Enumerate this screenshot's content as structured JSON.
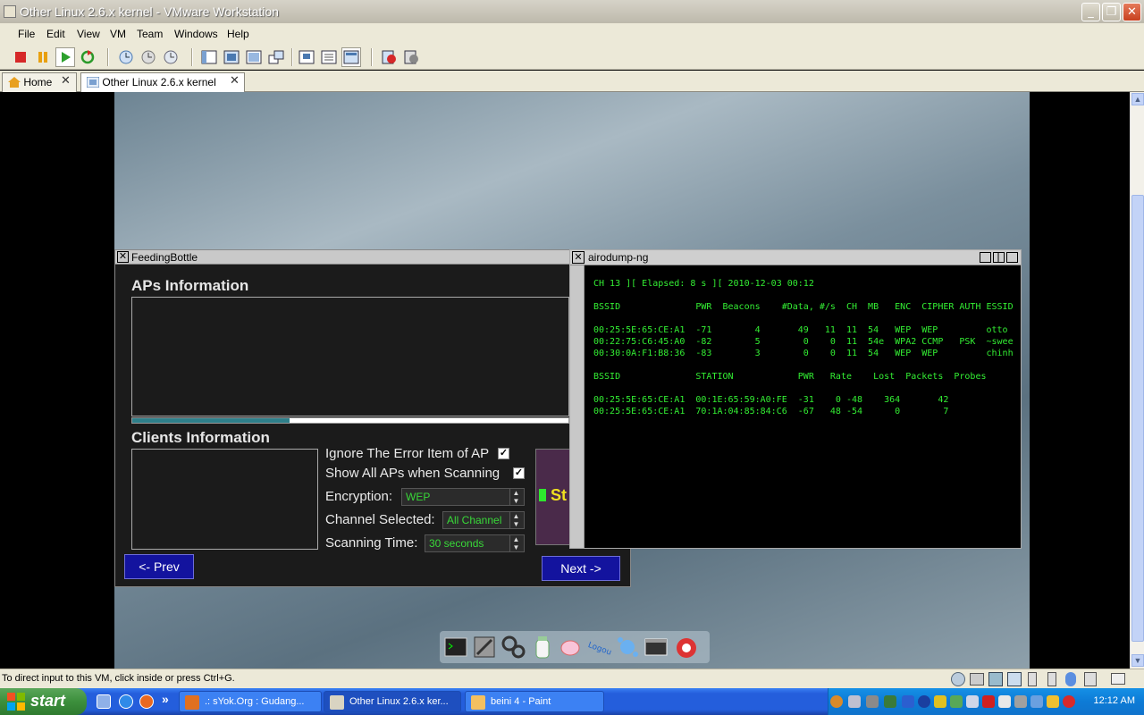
{
  "window": {
    "title": "Other Linux 2.6.x kernel - VMware Workstation",
    "minimize": "_",
    "maximize": "❐",
    "close": "✕"
  },
  "menu": [
    "File",
    "Edit",
    "View",
    "VM",
    "Team",
    "Windows",
    "Help"
  ],
  "tabs": [
    {
      "label": "Home",
      "icon": "home-icon"
    },
    {
      "label": "Other Linux 2.6.x kernel",
      "icon": "vm-icon"
    }
  ],
  "feedingbottle": {
    "title": "FeedingBottle",
    "aps_header": "APs Information",
    "clients_header": "Clients Information",
    "ignore_error_label": "Ignore The Error Item of AP",
    "show_all_label": "Show All APs when Scanning",
    "encryption_label": "Encryption:",
    "encryption_value": "WEP",
    "channel_label": "Channel Selected:",
    "channel_value": "All Channel",
    "scantime_label": "Scanning Time:",
    "scantime_value": "30 seconds",
    "start_label": "St",
    "prev_label": "<- Prev",
    "next_label": "Next ->",
    "scan_progress": 0.36
  },
  "airodump": {
    "title": "airodump-ng",
    "output": "CH 13 ][ Elapsed: 8 s ][ 2010-12-03 00:12\n\nBSSID              PWR  Beacons    #Data, #/s  CH  MB   ENC  CIPHER AUTH ESSID\n\n00:25:5E:65:CE:A1  -71        4       49   11  11  54   WEP  WEP         otto\n00:22:75:C6:45:A0  -82        5        0    0  11  54e  WPA2 CCMP   PSK  ~swee\n00:30:0A:F1:B8:36  -83        3        0    0  11  54   WEP  WEP         chinh\n\nBSSID              STATION            PWR   Rate    Lost  Packets  Probes\n\n00:25:5E:65:CE:A1  00:1E:65:59:A0:FE  -31    0 -48    364       42\n00:25:5E:65:CE:A1  70:1A:04:85:84:C6  -67   48 -54      0        7"
  },
  "statusbar": {
    "text": "To direct input to this VM, click inside or press Ctrl+G."
  },
  "taskbar": {
    "start": "start",
    "chevron": "»",
    "tasks": [
      {
        "label": ".: sYok.Org : Gudang...",
        "color": "#e07020"
      },
      {
        "label": "Other Linux 2.6.x ker...",
        "color": "#d9d4c2"
      },
      {
        "label": "beini 4 - Paint",
        "color": "#f4c060"
      }
    ],
    "clock": "12:12 AM"
  },
  "colors": {
    "terminal_green": "#33ee33",
    "xp_blue": "#245edc",
    "nav_blue": "#13139e"
  }
}
